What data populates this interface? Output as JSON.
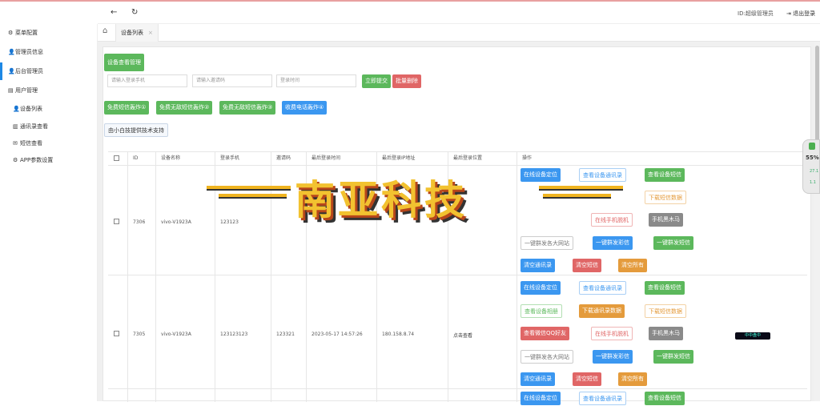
{
  "topbar": {
    "admin_label": "ID:超级管理员",
    "logout_label": "退出登录",
    "back_icon": "←",
    "refresh_icon": "↻"
  },
  "sidebar": {
    "items": [
      {
        "label": "菜单配置",
        "icon": "⚙"
      },
      {
        "label": "管理员信息",
        "icon": "👤"
      },
      {
        "label": "后台管理员",
        "icon": "👤"
      },
      {
        "label": "用户管理",
        "icon": "▤"
      },
      {
        "label": "设备列表",
        "icon": "👤"
      },
      {
        "label": "通讯录查看",
        "icon": "▥"
      },
      {
        "label": "短信查看",
        "icon": "✉"
      },
      {
        "label": "APP参数设置",
        "icon": "⚙"
      }
    ]
  },
  "tabs": {
    "home_icon": "⌂",
    "current": "设备列表",
    "close": "×"
  },
  "toolbar": {
    "manage_button": "设备查看管理",
    "phone_placeholder": "请输入登录手机",
    "invite_placeholder": "请输入邀请码",
    "time_placeholder": "登录时间",
    "submit_button": "立即提交",
    "batch_delete_button": "批量删除",
    "free_buttons": [
      "免费短信轰炸①",
      "免费无敌短信轰炸②",
      "免费无敌短信轰炸③",
      "收费电话轰炸④"
    ],
    "support_button": "由小白技提供技术支持"
  },
  "table": {
    "headers": [
      "ID",
      "设备名称",
      "登录手机",
      "邀请码",
      "最后登录时间",
      "最后登录IP地址",
      "最后登录位置",
      "操作"
    ],
    "rows": [
      {
        "id": "7306",
        "device": "vivo-V1923A",
        "phone": "123123",
        "invite": "",
        "time": "",
        "ip": "",
        "location": ""
      },
      {
        "id": "7305",
        "device": "vivo-V1923A",
        "phone": "123123123",
        "invite": "123321",
        "time": "2023-05-17 14:57:26",
        "ip": "180.158.8.74",
        "location": "点击查看"
      }
    ],
    "actions": {
      "locate": "在线设备定位",
      "contacts": "查看设备通讯录",
      "sms": "查看设备短信",
      "album": "查看设备相册",
      "download_contacts": "下载通讯录数据",
      "download_sms": "下载短信数据",
      "qq": "查看微信QQ好友",
      "online_shutdown": "在线手机脱机",
      "trojan": "手机黑木马",
      "mass_site": "一键群发各大网站",
      "mass_mms": "一键群发彩信",
      "mass_sms": "一键群发短信",
      "clear_contacts": "清空通讯录",
      "clear_sms": "清空短信",
      "clear_all": "清空所有"
    }
  },
  "watermark": {
    "text": "南亚科技"
  },
  "widget": {
    "percent": "55%",
    "line1": "27.1",
    "line2": "1.1"
  },
  "badge": {
    "text": "中中盘中"
  }
}
